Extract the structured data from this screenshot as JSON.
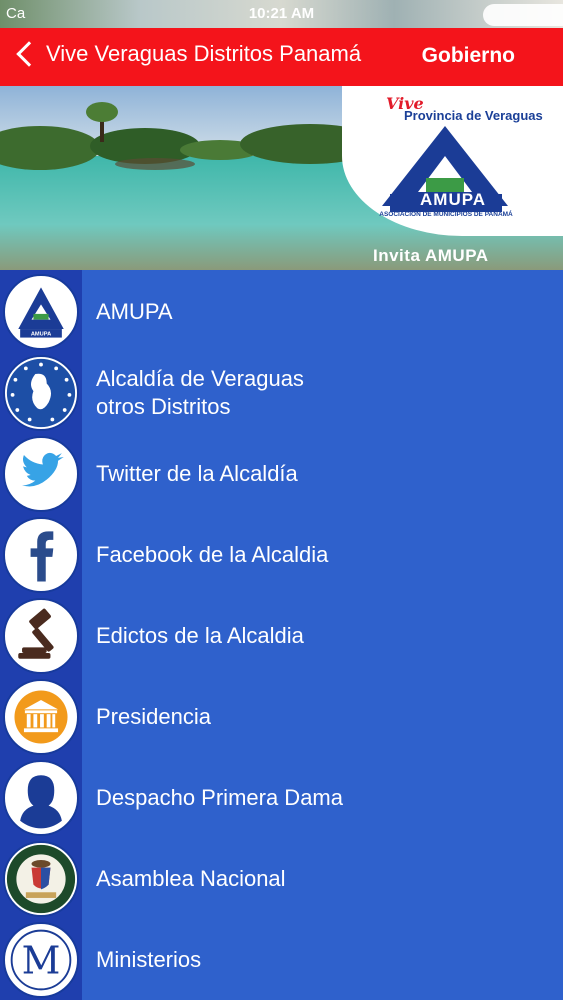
{
  "status_bar": {
    "carrier": "Ca",
    "time": "10:21 AM"
  },
  "nav": {
    "back_label": "Vive Veraguas Distritos Panamá",
    "right_label": "Gobierno"
  },
  "banner": {
    "vive": "Vive",
    "provincia": "Provincia de Veraguas",
    "logo_word": "AMUPA",
    "logo_subtitle": "ASOCIACIÓN DE MUNICIPIOS DE PANAMÁ",
    "invite": "Invita AMUPA"
  },
  "menu": {
    "items": [
      {
        "label": "AMUPA",
        "icon": "amupa-logo-icon"
      },
      {
        "label": "Alcaldía de Veraguas\notros Distritos",
        "icon": "veraguas-map-icon"
      },
      {
        "label": "Twitter de la Alcaldía",
        "icon": "twitter-bird-icon"
      },
      {
        "label": "Facebook de la  Alcaldia",
        "icon": "facebook-icon"
      },
      {
        "label": "Edictos de la Alcaldia",
        "icon": "gavel-icon"
      },
      {
        "label": "Presidencia",
        "icon": "government-building-icon"
      },
      {
        "label": "Despacho Primera Dama",
        "icon": "woman-silhouette-icon"
      },
      {
        "label": "Asamblea Nacional",
        "icon": "national-assembly-seal-icon"
      },
      {
        "label": "Ministerios",
        "icon": "letter-m-icon"
      }
    ]
  },
  "colors": {
    "nav_red": "#f4141b",
    "menu_blue": "#2f61cc",
    "icon_column_blue": "#1f3fae"
  }
}
